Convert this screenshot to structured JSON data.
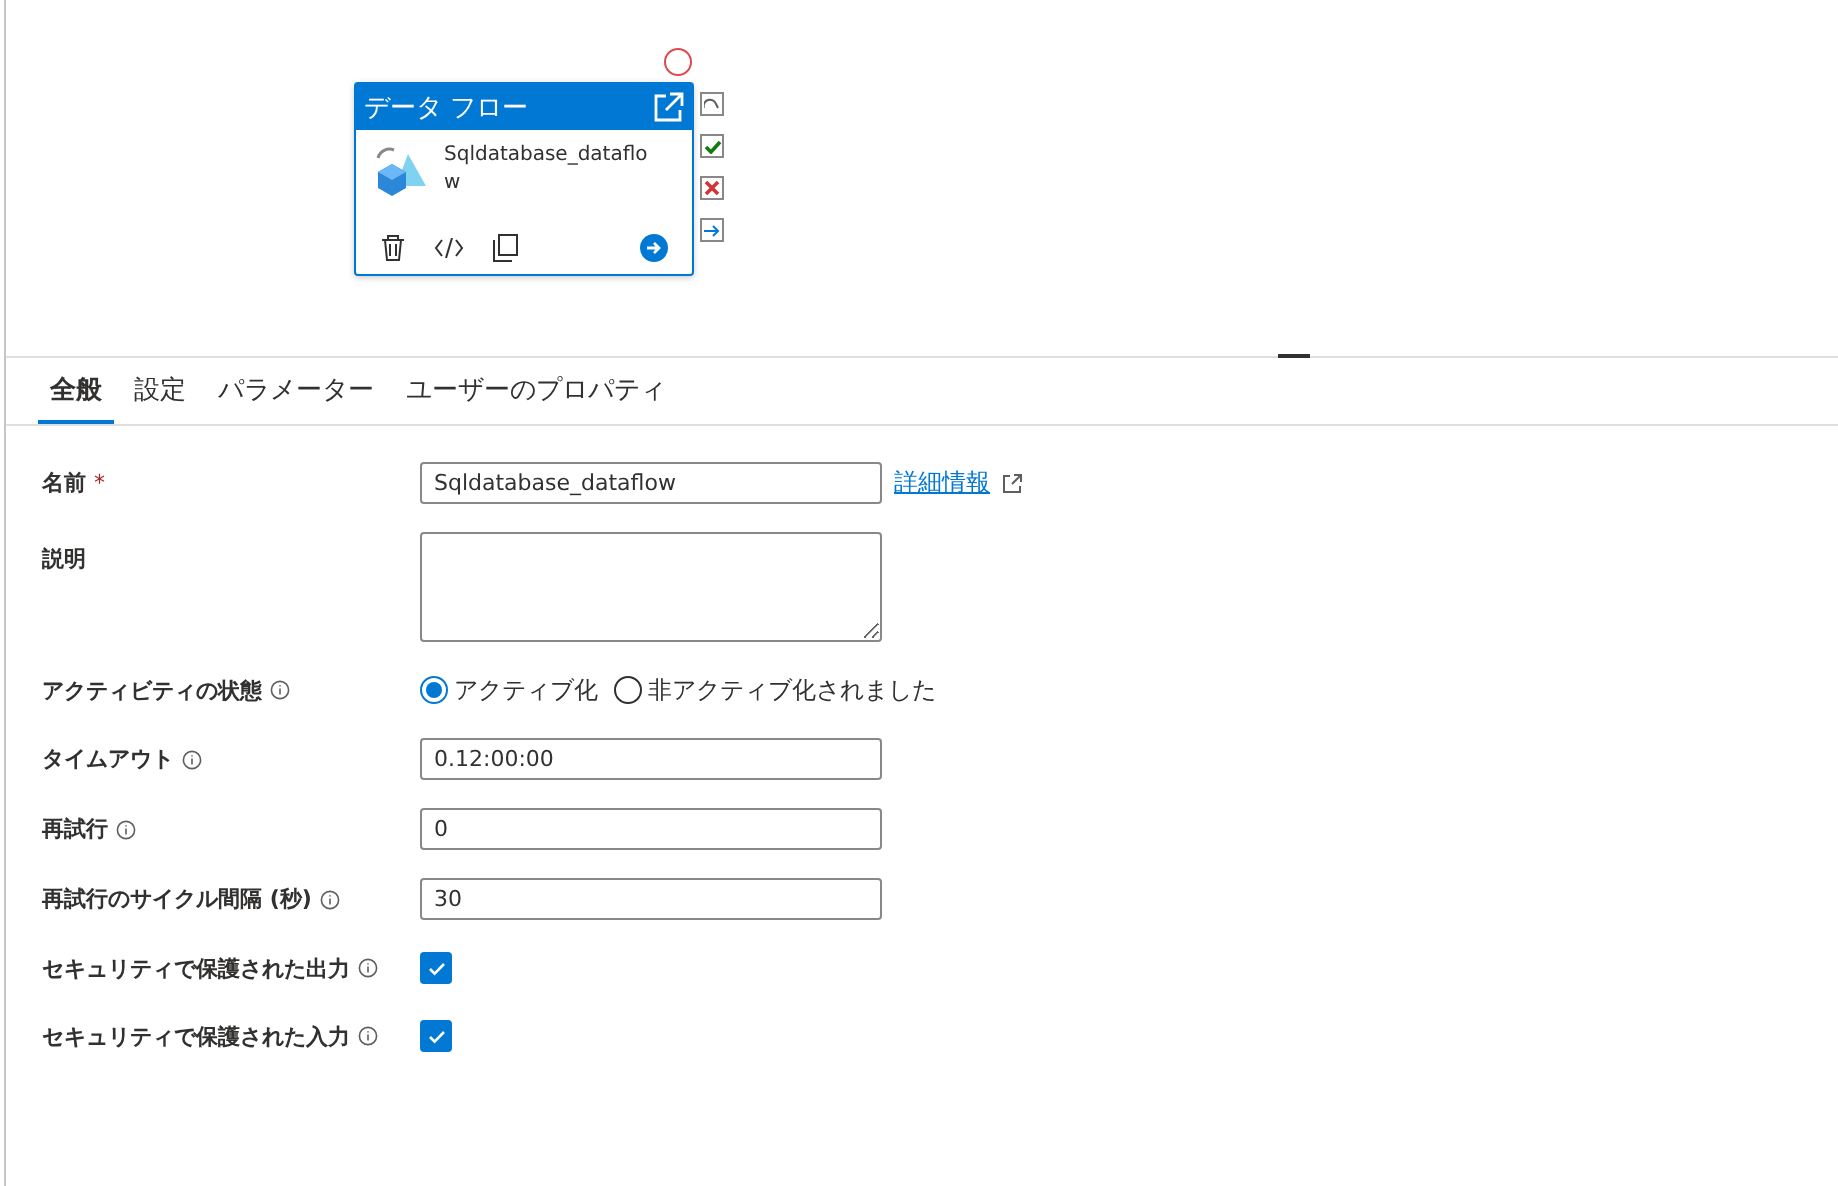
{
  "canvas": {
    "node": {
      "title": "データ フロー",
      "name": "Sqldatabase_dataflow"
    }
  },
  "tabs": [
    {
      "label": "全般",
      "selected": true
    },
    {
      "label": "設定",
      "selected": false
    },
    {
      "label": "パラメーター",
      "selected": false
    },
    {
      "label": "ユーザーのプロパティ",
      "selected": false
    }
  ],
  "fields": [
    {
      "kind": "text",
      "label": "名前",
      "required_mark": "*",
      "value": "Sqldatabase_dataflow",
      "link": "詳細情報",
      "info": false
    },
    {
      "kind": "textarea",
      "label": "説明",
      "info": false
    },
    {
      "kind": "radio",
      "label": "アクティビティの状態",
      "info": true,
      "options": [
        {
          "label": "アクティブ化",
          "selected": true
        },
        {
          "label": "非アクティブ化されました",
          "selected": false
        }
      ]
    },
    {
      "kind": "text",
      "label": "タイムアウト",
      "value": "0.12:00:00",
      "info": true
    },
    {
      "kind": "text",
      "label": "再試行",
      "value": "0",
      "info": true
    },
    {
      "kind": "text",
      "label": "再試行のサイクル間隔 (秒)",
      "value": "30",
      "info": true
    },
    {
      "kind": "checkbox",
      "label": "セキュリティで保護された出力",
      "info": true,
      "checked": true
    },
    {
      "kind": "checkbox",
      "label": "セキュリティで保護された入力",
      "info": true,
      "checked": true
    }
  ]
}
